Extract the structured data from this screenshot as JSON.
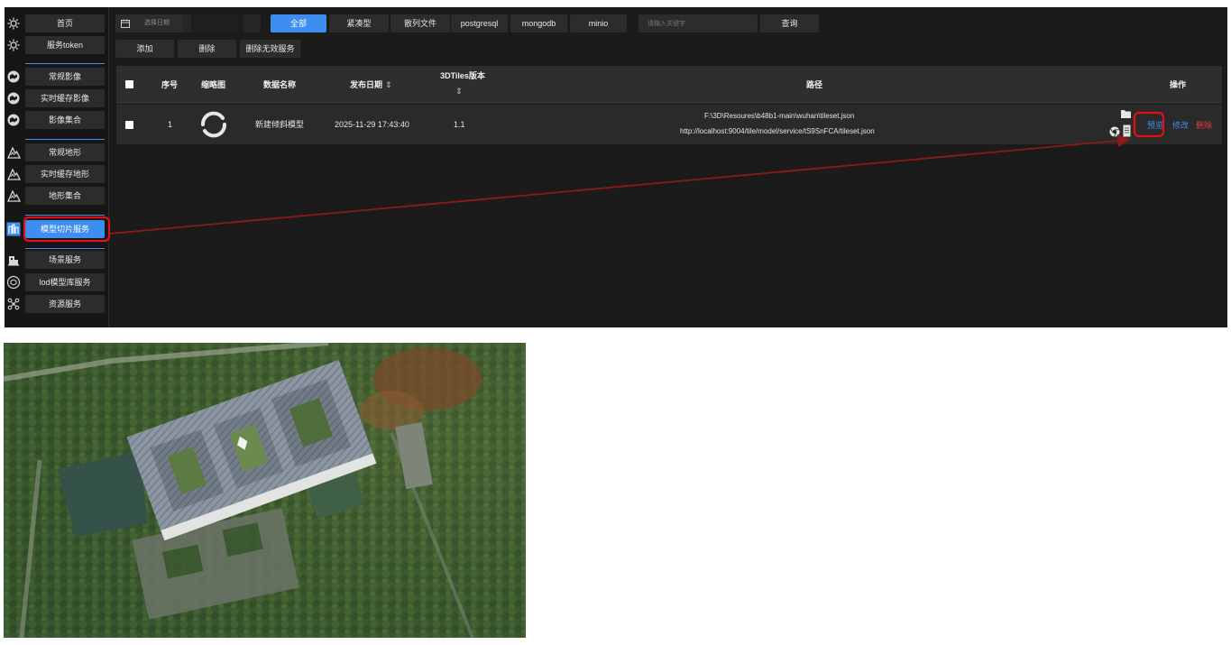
{
  "sidebar": {
    "items": [
      {
        "label": "首页",
        "icon": "gear-icon"
      },
      {
        "label": "服务token",
        "icon": "gear-icon"
      },
      {
        "label": "常规影像",
        "icon": "image-globe-icon"
      },
      {
        "label": "实时缓存影像",
        "icon": "image-globe-icon"
      },
      {
        "label": "影像集合",
        "icon": "image-globe-icon"
      },
      {
        "label": "常规地形",
        "icon": "terrain-icon"
      },
      {
        "label": "实时缓存地形",
        "icon": "terrain-icon"
      },
      {
        "label": "地形集合",
        "icon": "terrain-icon"
      },
      {
        "label": "模型切片服务",
        "icon": "model-tile-icon",
        "active": true
      },
      {
        "label": "场景服务",
        "icon": "scene-icon"
      },
      {
        "label": "lod模型库服务",
        "icon": "lod-icon"
      },
      {
        "label": "资源服务",
        "icon": "resource-icon"
      }
    ]
  },
  "toolbar": {
    "date_placeholder": "选择日期",
    "filters": [
      "全部",
      "紧凑型",
      "散列文件",
      "postgresql",
      "mongodb",
      "minio"
    ],
    "active_filter": "全部",
    "search_placeholder": "请输入关键字",
    "search_label": "查询",
    "add_label": "添加",
    "delete_label": "删除",
    "delete_invalid_label": "删除无效服务"
  },
  "table": {
    "headers": {
      "index": "序号",
      "thumbnail": "缩略图",
      "name": "数据名称",
      "date": "发布日期",
      "version": "3DTiles版本",
      "path": "路径",
      "ops": "操作"
    },
    "sort_glyph": "⇕",
    "rows": [
      {
        "index": "1",
        "name": "新建倾斜模型",
        "date": "2025-11-29 17:43:40",
        "version": "1.1",
        "path_local": "F:\\3D\\Resoures\\b48b1-main\\wuhan\\tileset.json",
        "path_url": "http://localhost:9004/tile/model/service/tS9SnFCA/tileset.json",
        "actions": {
          "preview": "预览",
          "edit": "修改",
          "delete": "删除"
        }
      }
    ]
  },
  "colors": {
    "accent": "#3e8ef0",
    "danger": "#e23b3b",
    "highlight_box": "#e0101a",
    "arrow": "#8b1a1a"
  }
}
